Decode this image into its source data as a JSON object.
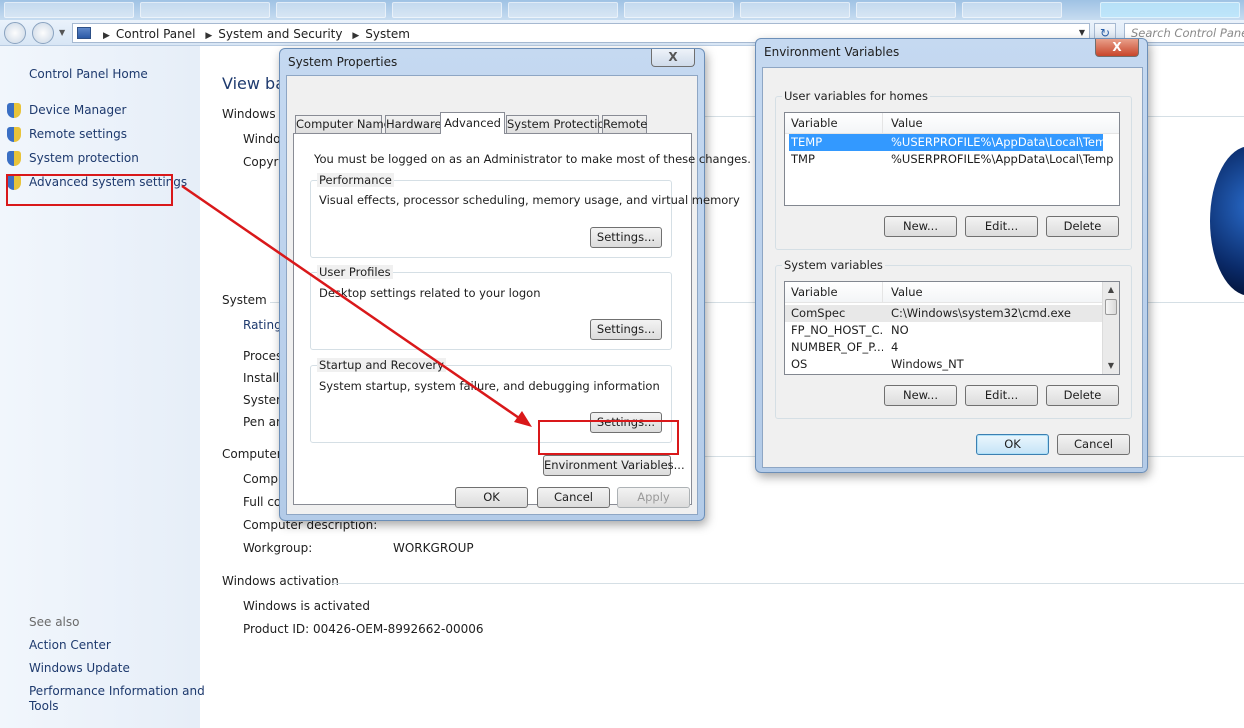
{
  "explorer": {
    "breadcrumbs": [
      "Control Panel",
      "System and Security",
      "System"
    ],
    "search_placeholder": "Search Control Panel",
    "refresh_glyph": "↻"
  },
  "sidebar": {
    "home": "Control Panel Home",
    "links": [
      "Device Manager",
      "Remote settings",
      "System protection",
      "Advanced system settings"
    ],
    "see_also_heading": "See also",
    "see_also": [
      "Action Center",
      "Windows Update",
      "Performance Information and",
      "Tools"
    ]
  },
  "main": {
    "view_basic": "View ba",
    "windows_edition_heading": "Windows e",
    "windows_edition_rows": [
      "Windo",
      "Copyri"
    ],
    "system_heading": "System",
    "system_rows": [
      "Ratings",
      "Proces",
      "Installe",
      "System",
      "Pen an"
    ],
    "computer_heading": "Computer",
    "computer_rows": [
      "Compu",
      "Full co",
      "Computer description:",
      "Workgroup:"
    ],
    "workgroup_value": "WORKGROUP",
    "activation_heading": "Windows activation",
    "activation_status": "Windows is activated",
    "product_id": "Product ID:  00426-OEM-8992662-00006"
  },
  "system_properties": {
    "title": "System Properties",
    "close": "X",
    "tabs": [
      "Computer Name",
      "Hardware",
      "Advanced",
      "System Protection",
      "Remote"
    ],
    "active_tab": "Advanced",
    "admin_note": "You must be logged on as an Administrator to make most of these changes.",
    "groups": [
      {
        "label": "Performance",
        "desc": "Visual effects, processor scheduling, memory usage, and virtual memory",
        "button": "Settings..."
      },
      {
        "label": "User Profiles",
        "desc": "Desktop settings related to your logon",
        "button": "Settings..."
      },
      {
        "label": "Startup and Recovery",
        "desc": "System startup, system failure, and debugging information",
        "button": "Settings..."
      }
    ],
    "env_button": "Environment Variables...",
    "ok": "OK",
    "cancel": "Cancel",
    "apply": "Apply"
  },
  "env_vars": {
    "title": "Environment Variables",
    "close": "X",
    "user_group_label": "User variables for homes",
    "system_group_label": "System variables",
    "col_variable": "Variable",
    "col_value": "Value",
    "user_rows": [
      {
        "variable": "TEMP",
        "value": "%USERPROFILE%\\AppData\\Local\\Temp"
      },
      {
        "variable": "TMP",
        "value": "%USERPROFILE%\\AppData\\Local\\Temp"
      }
    ],
    "system_rows": [
      {
        "variable": "ComSpec",
        "value": "C:\\Windows\\system32\\cmd.exe"
      },
      {
        "variable": "FP_NO_HOST_C...",
        "value": "NO"
      },
      {
        "variable": "NUMBER_OF_P...",
        "value": "4"
      },
      {
        "variable": "OS",
        "value": "Windows_NT"
      }
    ],
    "new": "New...",
    "edit": "Edit...",
    "delete": "Delete",
    "ok": "OK",
    "cancel": "Cancel"
  },
  "colors": {
    "highlight_red": "#d9181a",
    "selection_blue": "#3399ff"
  }
}
